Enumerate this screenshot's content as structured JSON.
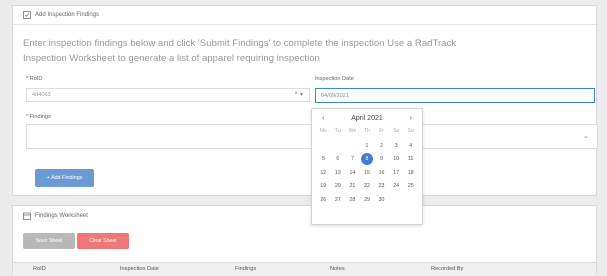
{
  "colors": {
    "accent": "#3e7fd0",
    "add_button": "#6b9bd2",
    "clear_button": "#ee7777",
    "save_button": "#b9b9b9"
  },
  "add_panel": {
    "title": "Add Inspection Findings",
    "intro": "Enter inspection findings below and click 'Submit Findings' to complete the inspection Use a RadTrack Inspection Worksheet to generate a list of apparel requiring inspection",
    "roid_label": "* RoID",
    "roid_value": "4d4063",
    "date_label": "Inspection Date",
    "date_value": "04/09/2021",
    "findings_label": "* Findings",
    "add_button": "+ Add Findings"
  },
  "calendar": {
    "month_label": "April 2021",
    "weekdays": [
      "Mo",
      "Tu",
      "We",
      "Th",
      "Fr",
      "Sa",
      "Su"
    ],
    "leading_blanks": 3,
    "days": [
      "1",
      "2",
      "3",
      "4",
      "5",
      "6",
      "7",
      "8",
      "9",
      "10",
      "11",
      "12",
      "13",
      "14",
      "15",
      "16",
      "17",
      "18",
      "19",
      "20",
      "21",
      "22",
      "23",
      "24",
      "25",
      "26",
      "27",
      "28",
      "29",
      "30"
    ],
    "selected_day": "8"
  },
  "worksheet_panel": {
    "title": "Findings Worksheet",
    "save_button": "Save Sheet",
    "clear_button": "Clear Sheet",
    "columns": [
      "RoID",
      "Inspection Date",
      "Findings",
      "Notes",
      "Recorded By"
    ]
  }
}
